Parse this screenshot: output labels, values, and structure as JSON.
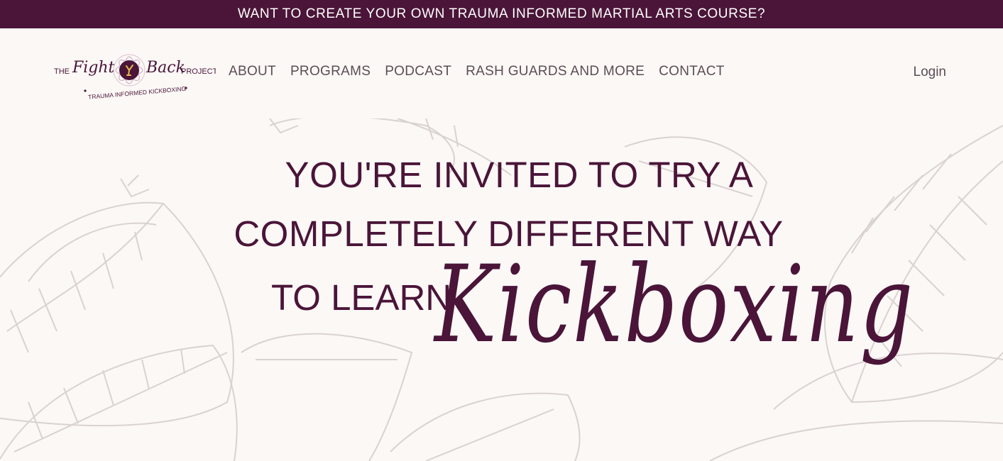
{
  "announcement": {
    "text": "WANT TO CREATE YOUR OWN TRAUMA INFORMED MARTIAL ARTS COURSE?"
  },
  "logo": {
    "word_the": "THE",
    "word_fight": "Fight",
    "word_back": "Back",
    "word_project": "PROJECT",
    "tagline": "TRAUMA INFORMED KICKBOXING"
  },
  "nav": {
    "items": [
      {
        "label": "ABOUT"
      },
      {
        "label": "PROGRAMS"
      },
      {
        "label": "PODCAST"
      },
      {
        "label": "RASH GUARDS AND MORE"
      },
      {
        "label": "CONTACT"
      }
    ],
    "login": "Login"
  },
  "hero": {
    "line1": "YOU'RE INVITED TO TRY A",
    "line2": "COMPLETELY DIFFERENT WAY",
    "line3": "TO LEARN",
    "script_word": "Kickboxing"
  },
  "colors": {
    "brand_plum": "#4a1538",
    "background": "#fcf8f6",
    "nav_text": "#5b4d55",
    "leaf_outline": "#d9d2d0"
  }
}
